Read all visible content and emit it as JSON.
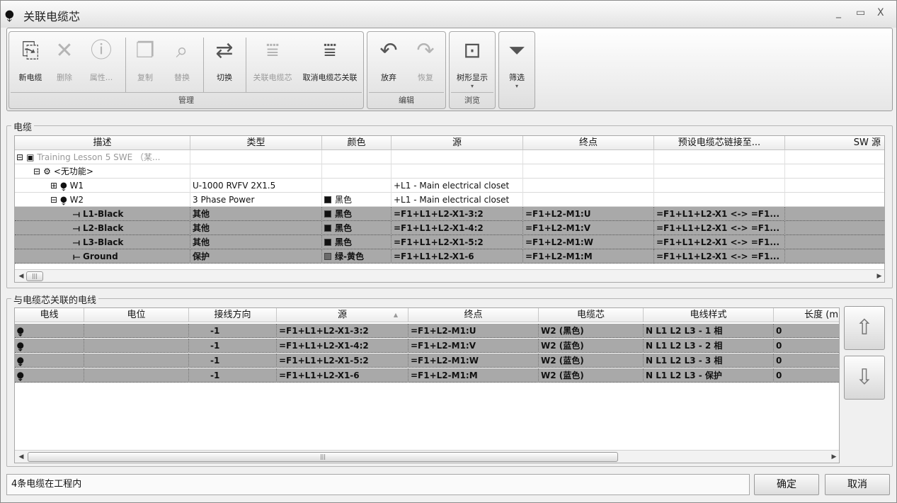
{
  "window": {
    "title": "关联电缆芯",
    "icon": "cable-icon",
    "min": "_",
    "max": "▭",
    "close": "X"
  },
  "ribbon": {
    "groups": [
      {
        "label": "管理",
        "buttons": [
          {
            "label": "新电缆",
            "icon": "new-cable-icon",
            "enabled": true
          },
          {
            "label": "删除",
            "icon": "delete-icon",
            "enabled": false
          },
          {
            "label": "属性...",
            "icon": "properties-icon",
            "enabled": false
          },
          {
            "label": "复制",
            "icon": "copy-icon",
            "enabled": false
          },
          {
            "label": "替换",
            "icon": "replace-icon",
            "enabled": false
          },
          {
            "label": "切换",
            "icon": "switch-icon",
            "enabled": true
          },
          {
            "label": "关联电缆芯",
            "icon": "assign-core-icon",
            "enabled": false
          },
          {
            "label": "取消电缆芯关联",
            "icon": "unassign-core-icon",
            "enabled": true
          }
        ]
      },
      {
        "label": "编辑",
        "buttons": [
          {
            "label": "放弃",
            "icon": "undo-icon",
            "enabled": true
          },
          {
            "label": "恢复",
            "icon": "redo-icon",
            "enabled": false
          }
        ]
      },
      {
        "label": "浏览",
        "buttons": [
          {
            "label": "树形显示",
            "icon": "tree-view-icon",
            "enabled": true
          }
        ]
      },
      {
        "label": "",
        "buttons": [
          {
            "label": "筛选",
            "icon": "filter-icon",
            "enabled": true
          }
        ]
      }
    ]
  },
  "cables_panel": {
    "title": "电缆",
    "columns": [
      "描述",
      "类型",
      "颜色",
      "源",
      "终点",
      "预设电缆芯链接至...",
      "SW 源"
    ],
    "rows": [
      {
        "expander": "⊟",
        "icon": "project-icon",
        "desc": "Training Lesson 5 SWE （某...",
        "type": "",
        "color": "",
        "swatch": "",
        "src": "",
        "dst": "",
        "preset": "",
        "sw": "",
        "selected": false,
        "gray": true
      },
      {
        "expander": "⊟",
        "icon": "function-icon",
        "desc": "<无功能>",
        "type": "",
        "color": "",
        "swatch": "",
        "src": "",
        "dst": "",
        "preset": "",
        "sw": "",
        "selected": false,
        "gray": false
      },
      {
        "expander": "⊞",
        "icon": "cable-icon",
        "desc": "W1",
        "type": "U-1000 RVFV 2X1.5",
        "color": "",
        "swatch": "",
        "src": "+L1 - Main electrical closet",
        "dst": "",
        "preset": "",
        "sw": "",
        "selected": false,
        "gray": false
      },
      {
        "expander": "⊟",
        "icon": "cable-icon",
        "desc": "W2",
        "type": "3 Phase Power",
        "color": "黑色",
        "swatch": "#111111",
        "src": "+L1 - Main electrical closet",
        "dst": "",
        "preset": "",
        "sw": "",
        "selected": false,
        "gray": false
      },
      {
        "expander": "",
        "icon": "core-icon",
        "desc": "L1-Black",
        "type": "其他",
        "color": "黑色",
        "swatch": "#111111",
        "src": "=F1+L1+L2-X1-3:2",
        "dst": "=F1+L2-M1:U",
        "preset": "=F1+L1+L2-X1 <-> =F1...",
        "sw": "",
        "selected": true,
        "gray": false
      },
      {
        "expander": "",
        "icon": "core-icon",
        "desc": "L2-Black",
        "type": "其他",
        "color": "黑色",
        "swatch": "#111111",
        "src": "=F1+L1+L2-X1-4:2",
        "dst": "=F1+L2-M1:V",
        "preset": "=F1+L1+L2-X1 <-> =F1...",
        "sw": "",
        "selected": true,
        "gray": false
      },
      {
        "expander": "",
        "icon": "core-icon",
        "desc": "L3-Black",
        "type": "其他",
        "color": "黑色",
        "swatch": "#111111",
        "src": "=F1+L1+L2-X1-5:2",
        "dst": "=F1+L2-M1:W",
        "preset": "=F1+L1+L2-X1 <-> =F1...",
        "sw": "",
        "selected": true,
        "gray": false
      },
      {
        "expander": "",
        "icon": "ground-core-icon",
        "desc": "Ground",
        "type": "保护",
        "color": "绿-黄色",
        "swatch": "#6b6b6b",
        "src": "=F1+L1+L2-X1-6",
        "dst": "=F1+L2-M1:M",
        "preset": "=F1+L1+L2-X1 <-> =F1...",
        "sw": "",
        "selected": true,
        "gray": false
      }
    ]
  },
  "wires_panel": {
    "title": "与电缆芯关联的电线",
    "columns": [
      "电线",
      "电位",
      "接线方向",
      "源",
      "终点",
      "电缆芯",
      "电线样式",
      "长度 (m"
    ],
    "sort_indicator": "▲",
    "rows": [
      {
        "icon": "wire-icon",
        "wire": "",
        "potential": "",
        "direction": "-1",
        "src": "=F1+L1+L2-X1-3:2",
        "dst": "=F1+L2-M1:U",
        "core": "W2 (黑色)",
        "style": "N L1 L2 L3 - 1 相",
        "length": "0"
      },
      {
        "icon": "wire-icon",
        "wire": "",
        "potential": "",
        "direction": "-1",
        "src": "=F1+L1+L2-X1-4:2",
        "dst": "=F1+L2-M1:V",
        "core": "W2 (蓝色)",
        "style": "N L1 L2 L3 - 2 相",
        "length": "0"
      },
      {
        "icon": "wire-icon",
        "wire": "",
        "potential": "",
        "direction": "-1",
        "src": "=F1+L1+L2-X1-5:2",
        "dst": "=F1+L2-M1:W",
        "core": "W2 (蓝色)",
        "style": "N L1 L2 L3 - 3 相",
        "length": "0"
      },
      {
        "icon": "wire-icon",
        "wire": "",
        "potential": "",
        "direction": "-1",
        "src": "=F1+L1+L2-X1-6",
        "dst": "=F1+L2-M1:M",
        "core": "W2 (蓝色)",
        "style": "N L1 L2 L3 - 保护",
        "length": "0"
      }
    ]
  },
  "status": "4条电缆在工程内",
  "buttons": {
    "ok": "确定",
    "cancel": "取消"
  }
}
